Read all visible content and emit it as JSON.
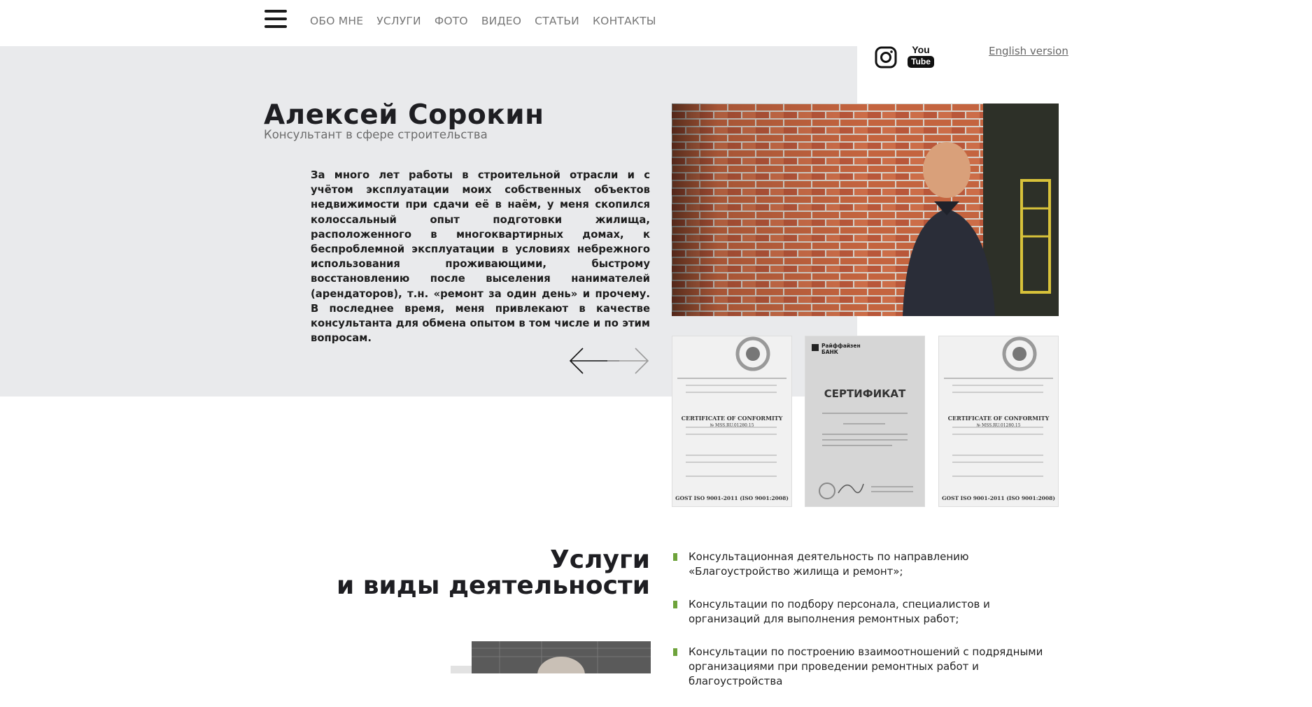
{
  "nav": {
    "menu_icon": "hamburger-menu-icon",
    "items": [
      "ОБО МНЕ",
      "УСЛУГИ",
      "ФОТО",
      "ВИДЕО",
      "СТАТЬИ",
      "КОНТАКТЫ"
    ]
  },
  "social": {
    "instagram_icon": "instagram-icon",
    "youtube_icon": "youtube-icon",
    "youtube_you": "You",
    "youtube_tube": "Tube"
  },
  "lang_link": "English version",
  "hero": {
    "name": "Алексей Сорокин",
    "subtitle": "Консультант в сфере строительства",
    "about": "За много лет работы в строительной отрасли и с учётом эксплуатации моих собственных объектов недвижимости при сдачи её в наём, у меня скопился колоссальный опыт подготовки жилища, расположенного в многоквартирных домах, к беспроблемной эксплуатации в условиях небрежного использования проживающими, быстрому восстановлению после выселения нанимателей (арендаторов), т.н. «ремонт за один день» и прочему. В последнее время, меня привлекают в качестве консультанта для обмена опытом в том числе и по этим вопросам."
  },
  "certificates": [
    {
      "heading": "CERTIFICATE OF CONFORMITY",
      "number": "№ MSS.RU.01280.15",
      "standard": "GOST ISO 9001-2011 (ISO 9001:2008)"
    },
    {
      "bank": "Райффайзен БАНК",
      "heading": "СЕРТИФИКАТ"
    },
    {
      "heading": "CERTIFICATE OF CONFORMITY",
      "number": "№ MSS.RU.01280.15",
      "standard": "GOST ISO 9001-2011 (ISO 9001:2008)"
    }
  ],
  "services": {
    "title_line1": "Услуги",
    "title_line2": "и виды деятельности",
    "items": [
      "Консультационная деятельность по направлению «Благоустройство жилища и ремонт»;",
      "Консультации по подбору персонала, специалистов и организаций для выполнения ремонтных работ;",
      "Консультации по построению взаимоотношений с подрядными организациями при проведении ремонтных работ и благоустройства"
    ]
  },
  "colors": {
    "band": "#e9eaec",
    "accent_bullet": "#6ea33b",
    "nav_text": "#777777"
  }
}
